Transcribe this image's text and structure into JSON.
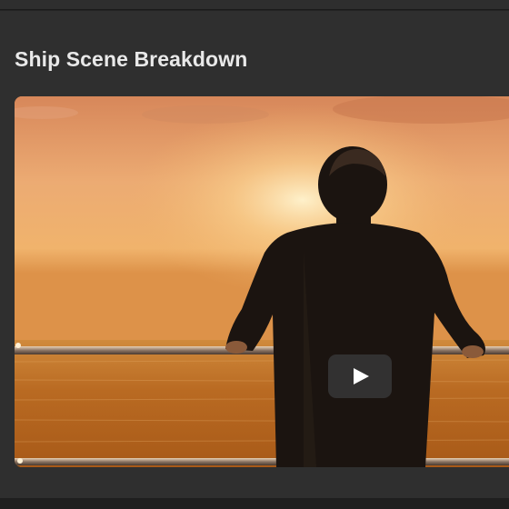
{
  "card": {
    "title": "Ship Scene Breakdown"
  },
  "video": {
    "play_icon": "play-icon",
    "scene_colors": {
      "sky_top": "#d98c55",
      "sky_glow": "#fbe0a8",
      "sea": "#b8681f",
      "figure": "#1b1410"
    }
  },
  "theme": {
    "page_bg": "#232323",
    "panel_bg": "#2f2f2f",
    "title_color": "#e9e9e9"
  }
}
